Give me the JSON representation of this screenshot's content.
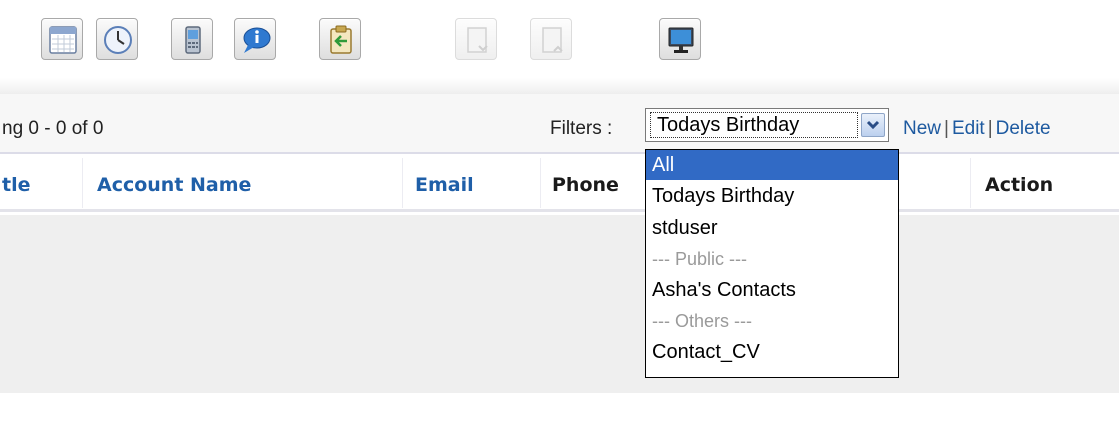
{
  "toolbar": {
    "buttons": [
      {
        "icon": "calendar-icon",
        "enabled": true
      },
      {
        "icon": "clock-icon",
        "enabled": true
      },
      {
        "icon": "mobile-phone-icon",
        "enabled": true
      },
      {
        "icon": "chat-bubble-icon",
        "enabled": true
      },
      {
        "icon": "clipboard-import-icon",
        "enabled": true
      },
      {
        "icon": "page-down-icon",
        "enabled": false
      },
      {
        "icon": "page-up-icon",
        "enabled": false
      },
      {
        "icon": "monitor-icon",
        "enabled": true
      }
    ]
  },
  "listbar": {
    "paging": "ng 0 - 0 of 0",
    "filters_label": "Filters :",
    "filter_selected": "Todays Birthday",
    "actions": {
      "new": "New",
      "edit": "Edit",
      "delete": "Delete",
      "separator": "|"
    }
  },
  "table": {
    "columns": [
      "tle",
      "Account Name",
      "Email",
      "Phone",
      "Action"
    ]
  },
  "dropdown": {
    "options": [
      {
        "label": "All",
        "selected": true,
        "group": false
      },
      {
        "label": "Todays Birthday",
        "selected": false,
        "group": false
      },
      {
        "label": "stduser",
        "selected": false,
        "group": false
      },
      {
        "label": "--- Public ---",
        "selected": false,
        "group": true
      },
      {
        "label": "Asha's Contacts",
        "selected": false,
        "group": false
      },
      {
        "label": "--- Others ---",
        "selected": false,
        "group": true
      },
      {
        "label": "Contact_CV",
        "selected": false,
        "group": false
      }
    ]
  },
  "colors": {
    "link": "#1f5fa8",
    "selection": "#316ac5",
    "body_background": "#efefef"
  }
}
